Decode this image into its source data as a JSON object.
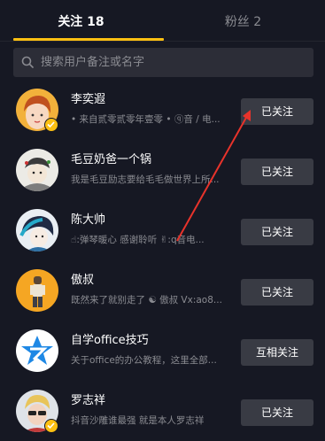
{
  "tabs": [
    {
      "label": "关注 18"
    },
    {
      "label": "粉丝 2"
    }
  ],
  "search": {
    "placeholder": "搜索用户备注或名字"
  },
  "users": [
    {
      "name": "李奕遐",
      "description": "• 来自贰零贰零年壹零 • ⓠ音 / 电...",
      "button": "已关注",
      "verified": true
    },
    {
      "name": "毛豆奶爸一个锅",
      "description": "我是毛豆励志要给毛毛做世界上所...",
      "button": "已关注",
      "verified": false
    },
    {
      "name": "陈大帅",
      "description": "☝:弹琴暖心 感谢聆听 ✌:q音电...",
      "button": "已关注",
      "verified": false
    },
    {
      "name": "傲叔",
      "description": "既然来了就别走了 ☯ 傲叔 Vx:ao8...",
      "button": "已关注",
      "verified": false
    },
    {
      "name": "自学office技巧",
      "description": "关于office的办公教程，这里全部...",
      "button": "互相关注",
      "verified": false
    },
    {
      "name": "罗志祥",
      "description": "抖音沙雕谁最强 就是本人罗志祥",
      "button": "已关注",
      "verified": true
    }
  ],
  "colors": {
    "accent": "#fdc012",
    "background": "#161823",
    "button": "#393b44",
    "annotation_arrow": "#e8332b"
  }
}
